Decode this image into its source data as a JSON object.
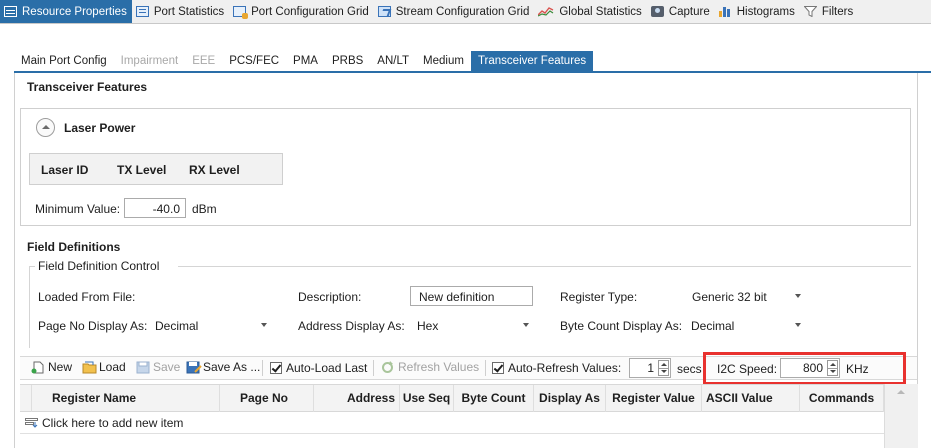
{
  "top_tabs": [
    {
      "label": "Resource Properties",
      "icon": "grid-icon",
      "active": true
    },
    {
      "label": "Port Statistics",
      "icon": "table-icon"
    },
    {
      "label": "Port Configuration Grid",
      "icon": "config-grid-icon"
    },
    {
      "label": "Stream Configuration Grid",
      "icon": "stream-grid-icon"
    },
    {
      "label": "Global Statistics",
      "icon": "line-chart-icon"
    },
    {
      "label": "Capture",
      "icon": "camera-icon"
    },
    {
      "label": "Histograms",
      "icon": "bar-chart-icon"
    },
    {
      "label": "Filters",
      "icon": "funnel-icon"
    }
  ],
  "sub_tabs": [
    {
      "label": "Main Port Config"
    },
    {
      "label": "Impairment",
      "disabled": true
    },
    {
      "label": "EEE",
      "disabled": true
    },
    {
      "label": "PCS/FEC"
    },
    {
      "label": "PMA"
    },
    {
      "label": "PRBS"
    },
    {
      "label": "AN/LT"
    },
    {
      "label": "Medium"
    },
    {
      "label": "Transceiver Features",
      "active": true
    }
  ],
  "page_title": "Transceiver Features",
  "laser_power": {
    "title": "Laser Power",
    "columns": [
      "Laser ID",
      "TX Level",
      "RX Level"
    ],
    "min_label": "Minimum Value:",
    "min_value": "-40.0",
    "min_unit": "dBm"
  },
  "field_definitions": {
    "title": "Field Definitions",
    "group_title": "Field Definition Control",
    "loaded_from_file_label": "Loaded From File:",
    "description_label": "Description:",
    "description_value": "New definition",
    "register_type_label": "Register Type:",
    "register_type_value": "Generic 32 bit",
    "page_no_label": "Page No Display As:",
    "page_no_value": "Decimal",
    "address_label": "Address Display As:",
    "address_value": "Hex",
    "byte_count_label": "Byte Count Display As:",
    "byte_count_value": "Decimal"
  },
  "toolbar": {
    "new": "New",
    "load": "Load",
    "save": "Save",
    "save_as": "Save As ...",
    "auto_load_last": "Auto-Load Last",
    "refresh_values": "Refresh Values",
    "auto_refresh_values": "Auto-Refresh Values:",
    "refresh_interval": "1",
    "secs": "secs",
    "i2c_speed_label": "I2C Speed:",
    "i2c_speed_value": "800",
    "i2c_speed_unit": "KHz"
  },
  "grid": {
    "columns": [
      "Register Name",
      "Page No",
      "Address",
      "Use Seq",
      "Byte Count",
      "Display As",
      "Register Value",
      "ASCII Value",
      "Commands"
    ],
    "add_row_text": "Click here to add new item"
  },
  "colors": {
    "accent": "#2a6ea8",
    "highlight": "#e8312e"
  }
}
